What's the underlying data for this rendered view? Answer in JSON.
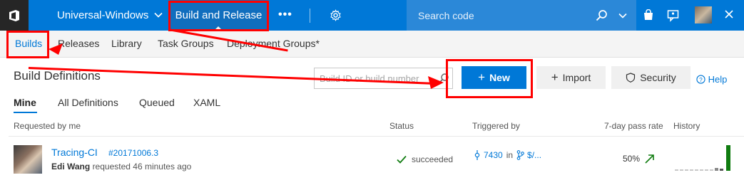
{
  "topbar": {
    "project": "Universal-Windows",
    "active_hub": "Build and Release",
    "more": "•••",
    "search_placeholder": "Search code"
  },
  "subnav": {
    "items": [
      "Builds",
      "Releases",
      "Library",
      "Task Groups",
      "Deployment Groups*"
    ]
  },
  "page": {
    "title": "Build Definitions",
    "filter_placeholder": "Build ID or build number",
    "new_label": "New",
    "import_label": "Import",
    "security_label": "Security",
    "help_label": "Help"
  },
  "tabs": [
    "Mine",
    "All Definitions",
    "Queued",
    "XAML"
  ],
  "table": {
    "columns": [
      "Requested by me",
      "Status",
      "Triggered by",
      "7-day pass rate",
      "History"
    ],
    "rows": [
      {
        "definition": "Tracing-CI",
        "build_number": "#20171006.3",
        "requester": "Edi Wang",
        "requested_text": "requested 46 minutes ago",
        "status": "succeeded",
        "commit": "7430",
        "in": "in",
        "branch": "$/...",
        "pass_rate": "50%"
      }
    ]
  },
  "colors": {
    "accent": "#0078d7",
    "success": "#107c10",
    "annotation": "#ff0000"
  }
}
